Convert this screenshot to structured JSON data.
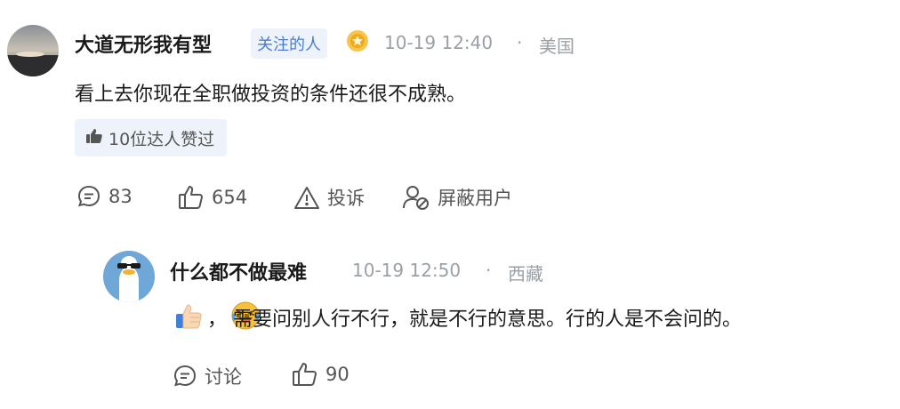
{
  "comment": {
    "author": "大道无形我有型",
    "author_tag": "关注的人",
    "time": "10-19 12:40",
    "location": "美国",
    "text": "看上去你现在全职做投资的条件还很不成熟。",
    "expert_likes": "10位达人赞过",
    "actions": {
      "comments_count": "83",
      "likes_count": "654",
      "report_label": "投诉",
      "block_label": "屏蔽用户"
    }
  },
  "reply": {
    "author": "什么都不做最难",
    "time": "10-19 12:50",
    "location": "西藏",
    "text": "，  需要问别人行不行，就是不行的意思。行的人是不会问的。",
    "actions": {
      "discuss_label": "讨论",
      "likes_count": "90"
    }
  },
  "colors": {
    "tag_bg": "#eef3fb",
    "tag_text": "#4a7cd6",
    "meta_text": "#9aa0a6"
  }
}
